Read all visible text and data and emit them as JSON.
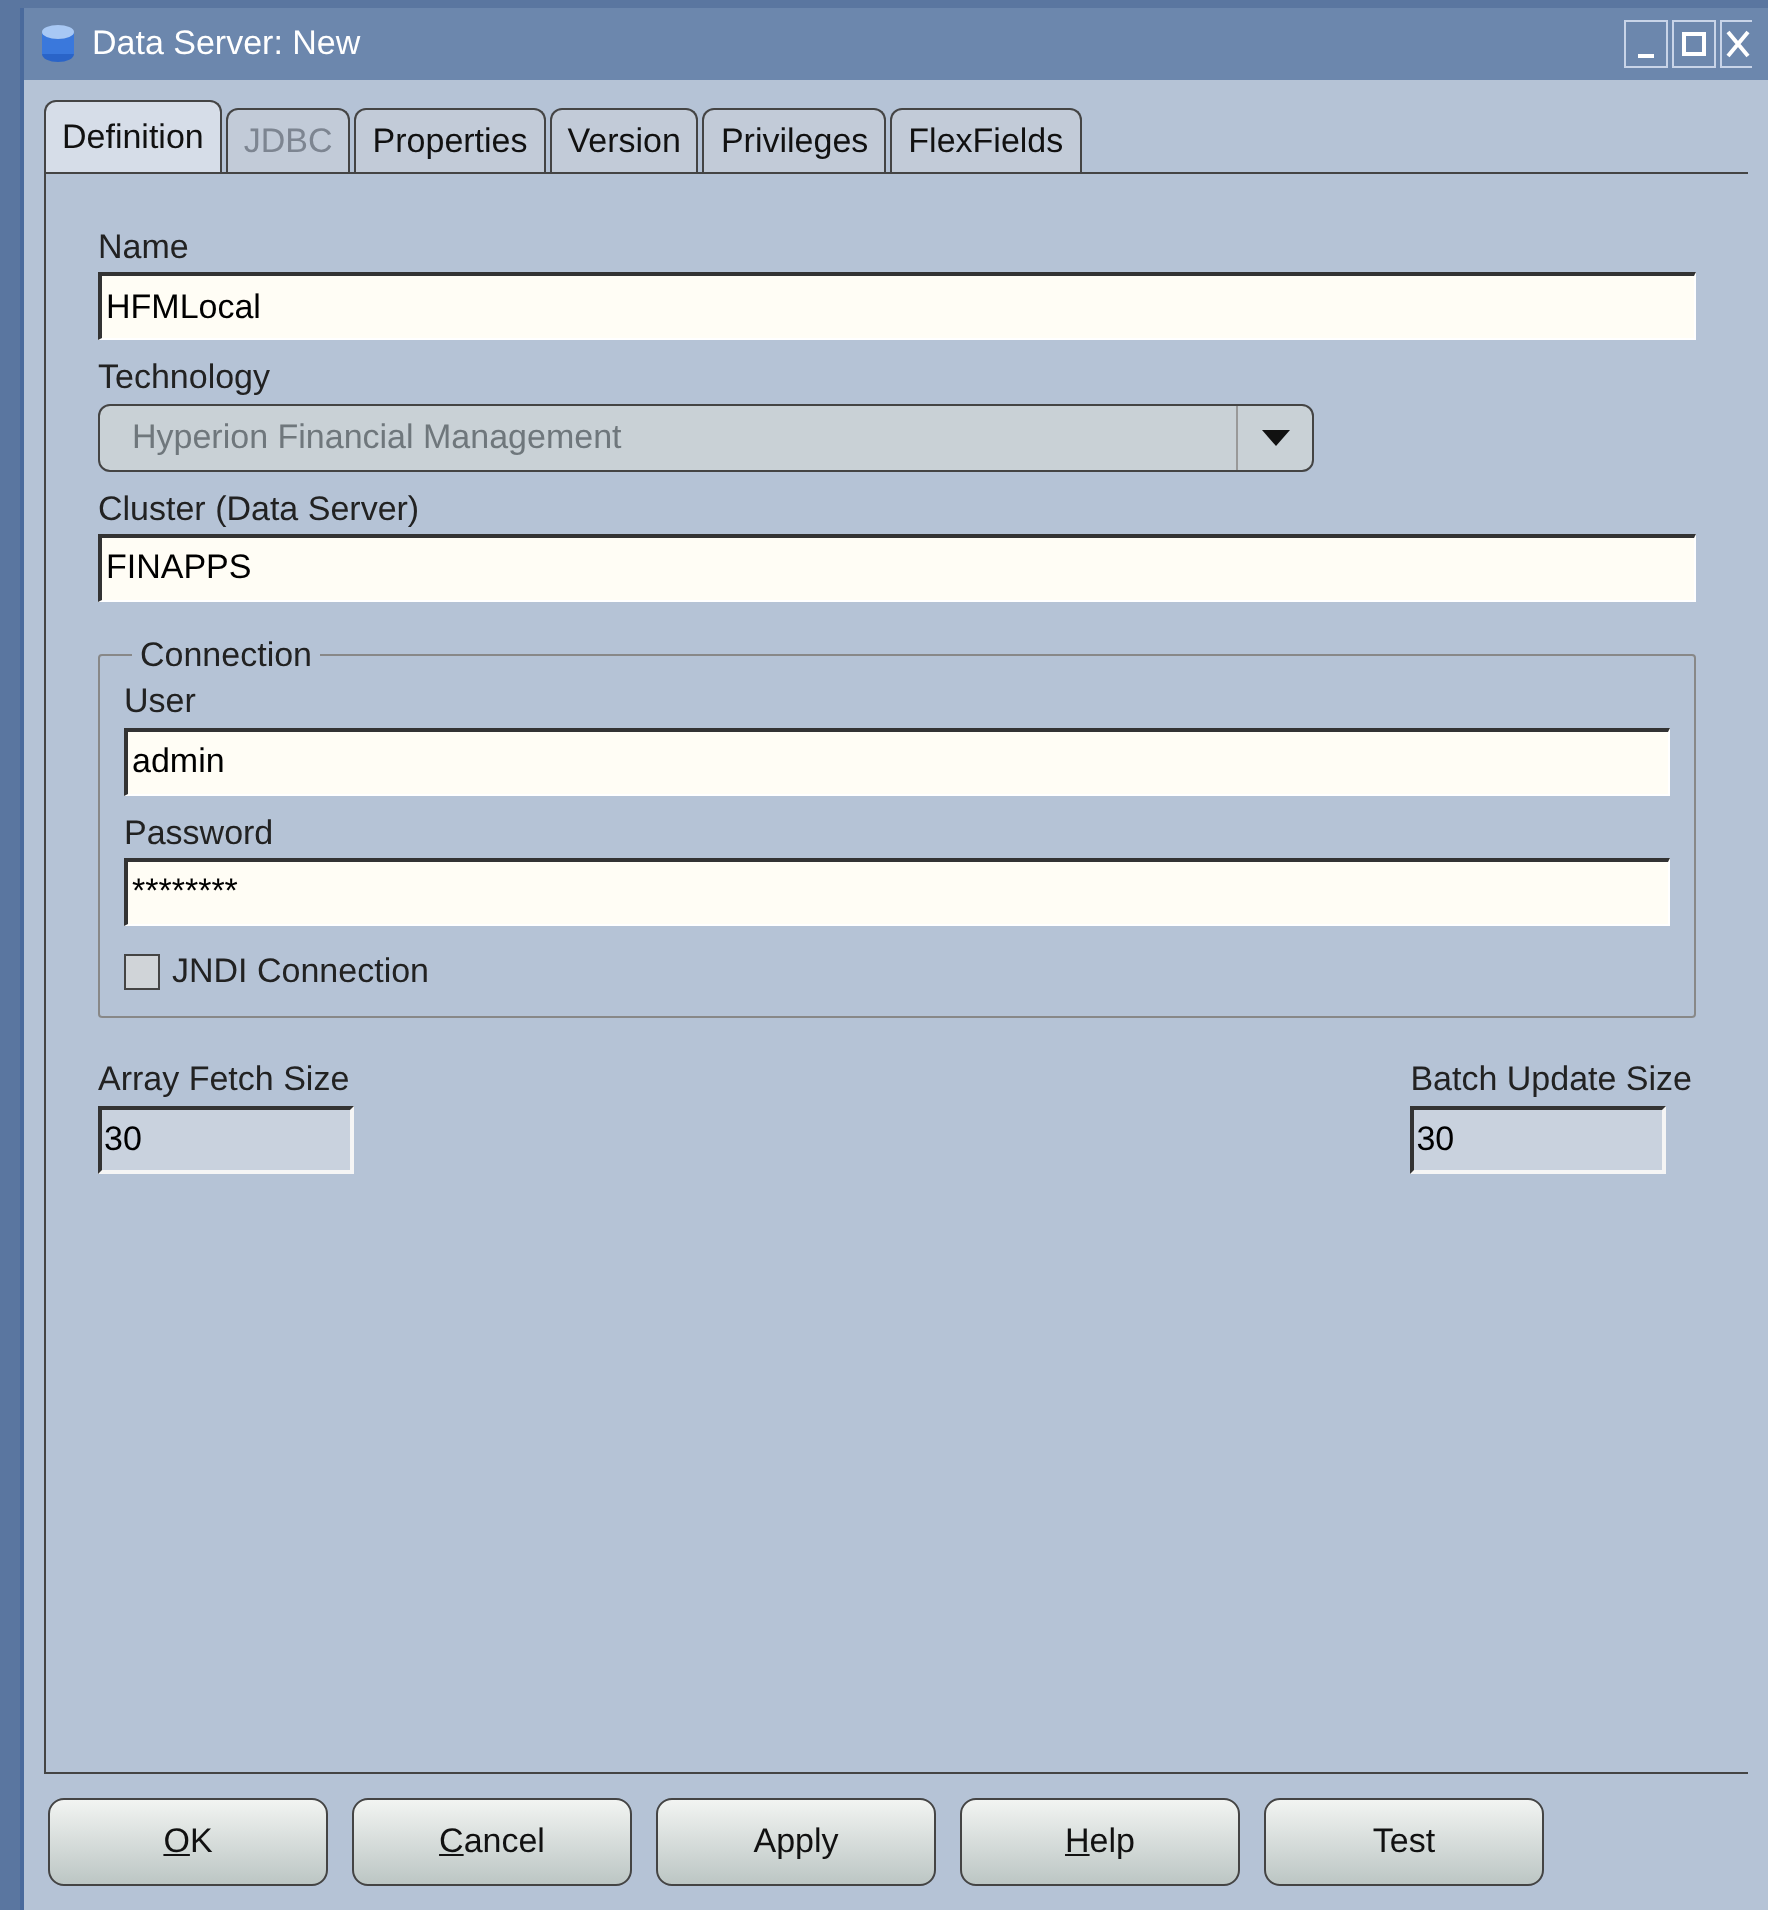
{
  "window": {
    "title": "Data Server: New"
  },
  "tabs": [
    {
      "label": "Definition",
      "selected": true,
      "disabled": false
    },
    {
      "label": "JDBC",
      "selected": false,
      "disabled": true
    },
    {
      "label": "Properties",
      "selected": false,
      "disabled": false
    },
    {
      "label": "Version",
      "selected": false,
      "disabled": false
    },
    {
      "label": "Privileges",
      "selected": false,
      "disabled": false
    },
    {
      "label": "FlexFields",
      "selected": false,
      "disabled": false
    }
  ],
  "name": {
    "label": "Name",
    "value": "HFMLocal"
  },
  "technology": {
    "label": "Technology",
    "value": "Hyperion Financial Management",
    "disabled": true
  },
  "cluster": {
    "label": "Cluster (Data Server)",
    "value": "FINAPPS"
  },
  "connection": {
    "title": "Connection",
    "user": {
      "label": "User",
      "value": "admin"
    },
    "password": {
      "label": "Password",
      "value": "********"
    },
    "jndi": {
      "label": "JNDI Connection",
      "checked": false
    }
  },
  "array_fetch_size": {
    "label": "Array Fetch Size",
    "value": "30"
  },
  "batch_update_size": {
    "label": "Batch Update Size",
    "value": "30"
  },
  "buttons": [
    {
      "mnemonic": "O",
      "rest": "K"
    },
    {
      "mnemonic": "C",
      "rest": "ancel"
    },
    {
      "rest": "Apply"
    },
    {
      "mnemonic": "H",
      "rest": "elp"
    },
    {
      "rest": "Test"
    }
  ]
}
